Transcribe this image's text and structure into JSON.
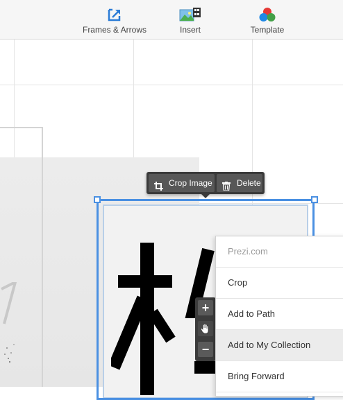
{
  "toolbar": {
    "frames_label": "Frames & Arrows",
    "insert_label": "Insert",
    "template_label": "Template",
    "accent_color": "#2a7bd6"
  },
  "image_toolbar": {
    "crop_label": "Crop Image",
    "delete_label": "Delete"
  },
  "zoom": {
    "in_symbol": "+",
    "out_symbol": "−"
  },
  "context_menu": {
    "header": "Prezi.com",
    "items": [
      "Crop",
      "Add to Path",
      "Add to My Collection",
      "Bring Forward"
    ],
    "highlighted": "Add to My Collection"
  },
  "colors": {
    "selection": "#4a90e2",
    "dark_bar": "#3a3a3a"
  }
}
